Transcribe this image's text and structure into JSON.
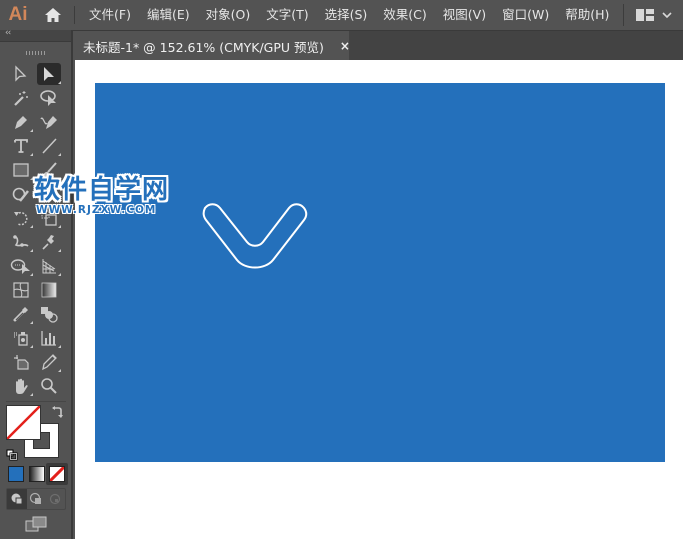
{
  "app": {
    "logo": "Ai",
    "accent_color": "#d2875a"
  },
  "menubar": {
    "items": [
      {
        "label": "文件(F)"
      },
      {
        "label": "编辑(E)"
      },
      {
        "label": "对象(O)"
      },
      {
        "label": "文字(T)"
      },
      {
        "label": "选择(S)"
      },
      {
        "label": "效果(C)"
      },
      {
        "label": "视图(V)"
      },
      {
        "label": "窗口(W)"
      },
      {
        "label": "帮助(H)"
      }
    ],
    "home_icon": "home-icon",
    "workspace_icon": "workspace-layout-icon"
  },
  "document_tab": {
    "title": "未标题-1* @ 152.61% (CMYK/GPU 预览)",
    "close_glyph": "×"
  },
  "toolbar": {
    "collapse_glyph": "‹‹",
    "tools": [
      {
        "name": "direct-selection-tool"
      },
      {
        "name": "selection-tool",
        "active": true
      },
      {
        "name": "magic-wand-tool"
      },
      {
        "name": "lasso-tool"
      },
      {
        "name": "pen-tool"
      },
      {
        "name": "curvature-tool"
      },
      {
        "name": "type-tool"
      },
      {
        "name": "line-segment-tool"
      },
      {
        "name": "rectangle-tool"
      },
      {
        "name": "paintbrush-tool"
      },
      {
        "name": "shaper-tool"
      },
      {
        "name": "pencil-tool"
      },
      {
        "name": "rotate-tool"
      },
      {
        "name": "scale-tool"
      },
      {
        "name": "puppet-warp-tool"
      },
      {
        "name": "pin-tool"
      },
      {
        "name": "shape-builder-tool"
      },
      {
        "name": "perspective-grid-tool"
      },
      {
        "name": "mesh-tool"
      },
      {
        "name": "gradient-tool"
      },
      {
        "name": "eyedropper-tool"
      },
      {
        "name": "blend-tool"
      },
      {
        "name": "symbol-sprayer-tool"
      },
      {
        "name": "column-graph-tool"
      },
      {
        "name": "artboard-tool"
      },
      {
        "name": "slice-tool"
      },
      {
        "name": "hand-tool"
      },
      {
        "name": "zoom-tool"
      }
    ],
    "fill": "none",
    "stroke": "#ffffff",
    "color_modes": [
      "color",
      "gradient",
      "none"
    ],
    "color_mode_color": "#2470bb",
    "draw_modes": [
      "draw-normal",
      "draw-behind",
      "draw-inside"
    ]
  },
  "canvas": {
    "artboard_color": "#2470bb",
    "shape": "rounded-v-chevron-outline",
    "shape_stroke": "#ffffff"
  },
  "watermark": {
    "title": "软件自学网",
    "url": "WWW.RJZXW.COM"
  }
}
